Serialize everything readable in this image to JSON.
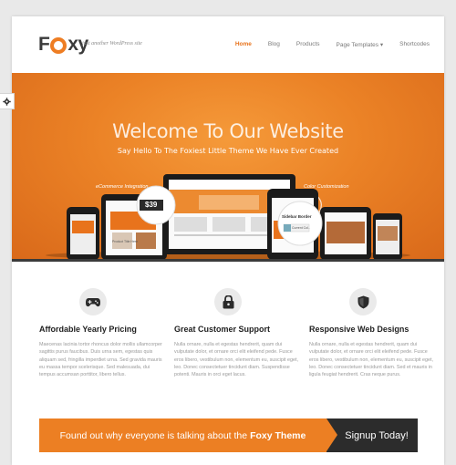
{
  "header": {
    "logo": "Foxy",
    "tagline": "just another WordPress site"
  },
  "nav": [
    {
      "label": "Home",
      "active": true
    },
    {
      "label": "Blog"
    },
    {
      "label": "Products"
    },
    {
      "label": "Page Templates ▾"
    },
    {
      "label": "Shortcodes"
    }
  ],
  "hero": {
    "title": "Welcome To Our Website",
    "subtitle": "Say Hello To The Foxiest Little Theme We Have Ever Created",
    "callout_left": "eCommerce Integration",
    "callout_right": "Color Customization",
    "price_badge": "$39",
    "sidebar_label": "Sidebar Border",
    "sidebar_current": "Current Col..",
    "product_label": "Product Title Here"
  },
  "features": [
    {
      "icon": "gamepad-icon",
      "title": "Affordable Yearly Pricing",
      "text": "Maecenas lacinia tortor rhoncus dolor mollis ullamcorper sagittis purus faucibus. Duis urna sem, egestas quis aliquam sed, fringilla imperdiet urna. Sed gravida mauris eu massa tempor scelerisque. Sed malesuada, dui tempus accumsan porttitor, libero tellus."
    },
    {
      "icon": "lock-icon",
      "title": "Great Customer Support",
      "text": "Nulla ornare, nulla et egestas hendrerit, quam dui vulputate dolor, et ornare orci elit eleifend pede. Fusce eros libero, vestibulum non, elementum eu, suscipit eget, leo. Donec consectetuer tincidunt diam. Suspendisse potenti. Mauris in orci eget lacus."
    },
    {
      "icon": "shield-icon",
      "title": "Responsive Web Designs",
      "text": "Nulla ornare, nulla et egestas hendrerit, quam dui vulputate dolor, et ornare orci elit eleifend pede. Fusce eros libero, vestibulum non, elementum eu, suscipit eget, leo. Donec consectetuer tincidunt diam. Sed et mauris in ligula feugiat hendrerit. Cras neque purus."
    }
  ],
  "cta": {
    "text": "Found out why everyone is talking about the",
    "highlight": "Foxy Theme",
    "button": "Signup Today!"
  },
  "colors": {
    "accent": "#ec7f23",
    "dark": "#2c2c2c"
  }
}
